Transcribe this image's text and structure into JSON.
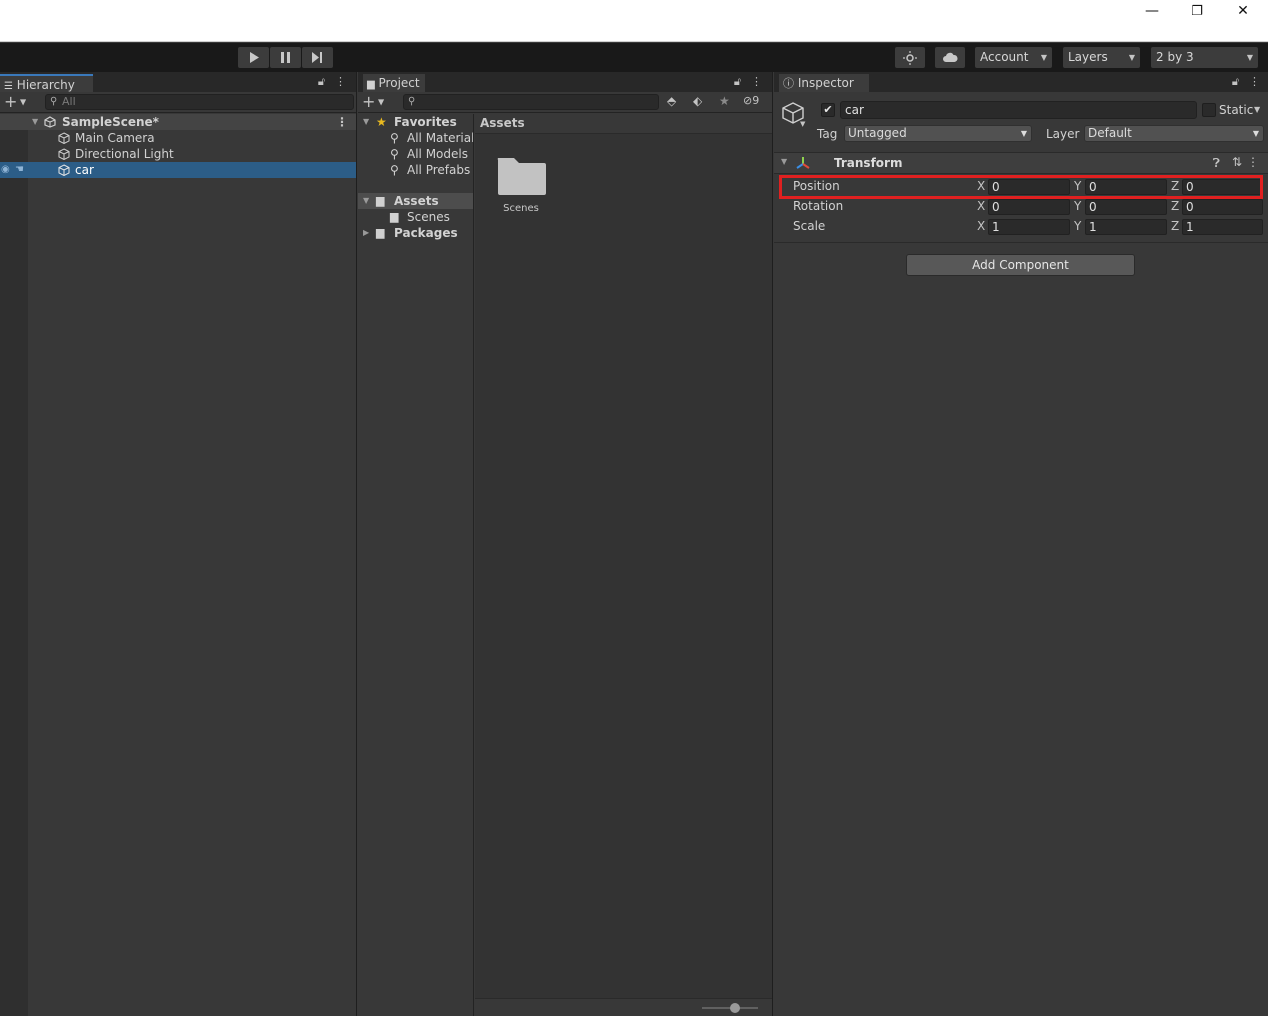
{
  "window": {
    "minimize": "—",
    "restore": "❐",
    "close": "✕"
  },
  "toolbar": {
    "play_icon": "play-icon",
    "pause_icon": "pause-icon",
    "step_icon": "step-icon",
    "account": "Account",
    "layers": "Layers",
    "layout": "2 by 3"
  },
  "hierarchy": {
    "tab": "Hierarchy",
    "search_placeholder": "All",
    "scene": "SampleScene*",
    "items": [
      {
        "label": "Main Camera"
      },
      {
        "label": "Directional Light"
      },
      {
        "label": "car",
        "selected": true
      }
    ]
  },
  "project": {
    "tab": "Project",
    "hidden_count": "9",
    "tree": {
      "favorites": "Favorites",
      "fav_items": [
        "All Materials",
        "All Models",
        "All Prefabs"
      ],
      "assets": "Assets",
      "scenes": "Scenes",
      "packages": "Packages"
    },
    "breadcrumb": "Assets",
    "folders": [
      {
        "label": "Scenes"
      }
    ]
  },
  "inspector": {
    "tab": "Inspector",
    "object_name": "car",
    "active": true,
    "static_label": "Static",
    "tag_label": "Tag",
    "tag_value": "Untagged",
    "layer_label": "Layer",
    "layer_value": "Default",
    "component": "Transform",
    "rows": [
      {
        "label": "Position",
        "x": "0",
        "y": "0",
        "z": "0"
      },
      {
        "label": "Rotation",
        "x": "0",
        "y": "0",
        "z": "0"
      },
      {
        "label": "Scale",
        "x": "1",
        "y": "1",
        "z": "1"
      }
    ],
    "axes": {
      "x": "X",
      "y": "Y",
      "z": "Z"
    },
    "add_component": "Add Component"
  },
  "colors": {
    "selection": "#2c5d87",
    "highlight": "#e02020",
    "panel": "#383838"
  }
}
